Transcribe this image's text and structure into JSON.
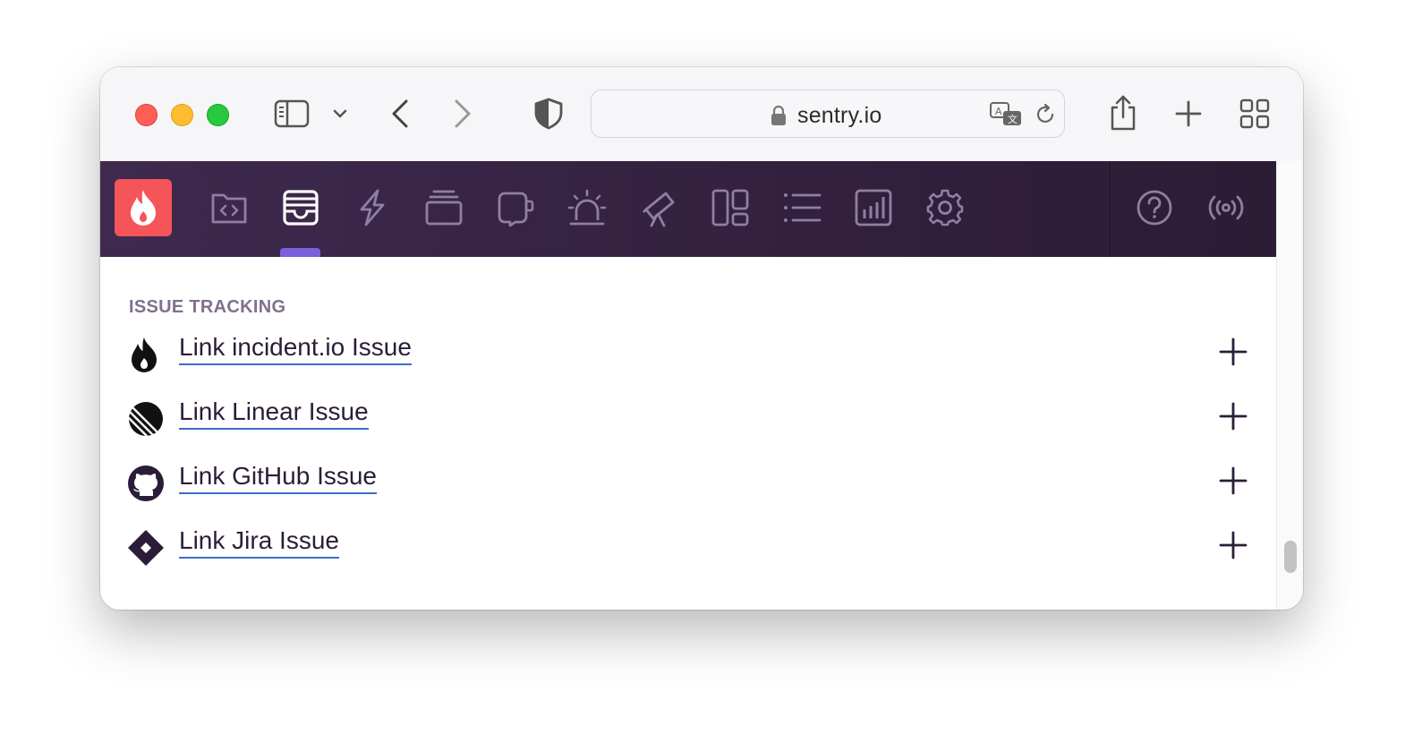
{
  "browser": {
    "url": "sentry.io"
  },
  "section": {
    "title": "ISSUE TRACKING"
  },
  "issue_links": [
    {
      "label": "Link incident.io Issue",
      "icon": "incident-io-icon"
    },
    {
      "label": "Link Linear Issue",
      "icon": "linear-icon"
    },
    {
      "label": "Link GitHub Issue",
      "icon": "github-icon"
    },
    {
      "label": "Link Jira Issue",
      "icon": "jira-icon"
    }
  ],
  "colors": {
    "nav_background": "#3f2a4f",
    "logo_background": "#f55459",
    "active_indicator": "#7a5fd8",
    "link_underline": "#3b6ecc"
  }
}
